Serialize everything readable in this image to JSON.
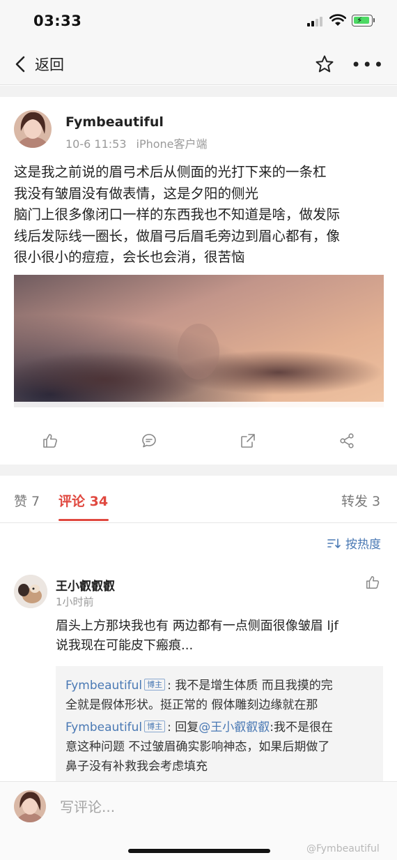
{
  "status_bar": {
    "time": "03:33"
  },
  "nav": {
    "back_label": "返回"
  },
  "post": {
    "author": "Fymbeautiful",
    "date": "10-6 11:53",
    "source": "iPhone客户端",
    "text_lines": [
      "这是我之前说的眉弓术后从侧面的光打下来的一条杠",
      "我没有皱眉没有做表情，这是夕阳的侧光",
      "脑门上很多像闭口一样的东西我也不知道是啥，做发际",
      "线后发际线一圈长，做眉弓后眉毛旁边到眉心都有，像",
      "很小很小的痘痘，会长也会消，很苦恼"
    ]
  },
  "tabs": {
    "likes": "赞 7",
    "comments": "评论 34",
    "reposts": "转发 3"
  },
  "sort": {
    "label": "按热度"
  },
  "comment": {
    "author": "王小叡叡叡",
    "time": "1小时前",
    "text_lines": [
      "眉头上方那块我也有 两边都有一点侧面很像皱眉 ljf",
      "说我现在可能皮下瘢痕..."
    ],
    "replies": [
      {
        "name": "Fymbeautiful",
        "badge": "博主",
        "line1": ": 我不是增生体质 而且我摸的完",
        "line2": "全就是假体形状。挺正常的 假体雕刻边缘就在那"
      },
      {
        "name": "Fymbeautiful",
        "badge": "博主",
        "prefix": ": 回复",
        "mention": "@王小叡叡叡",
        "line1": ":我不是很在",
        "line2": "意这种问题 不过皱眉确实影响神态，如果后期做了",
        "line3": "鼻子没有补救我会考虑填充"
      }
    ]
  },
  "bottom": {
    "input_placeholder": "写评论...",
    "watermark": "@Fymbeautiful"
  }
}
